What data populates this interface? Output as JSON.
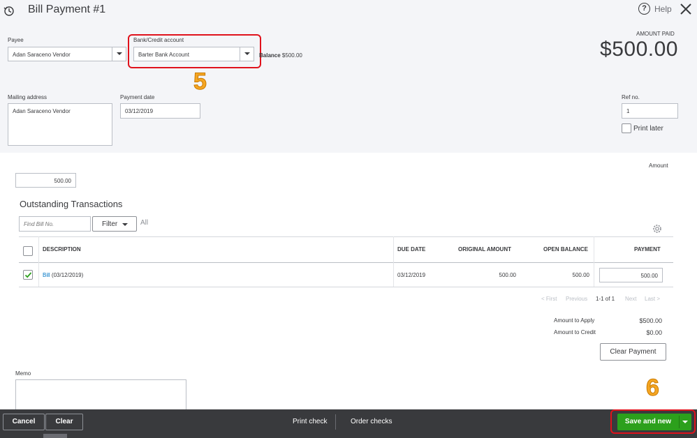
{
  "header": {
    "title": "Bill Payment",
    "number": "#1",
    "help_label": "Help"
  },
  "form": {
    "payee_label": "Payee",
    "payee_value": "Adan Saraceno Vendor",
    "bank_label": "Bank/Credit account",
    "bank_value": "Barter Bank Account",
    "balance_label": "Balance",
    "balance_value": "$500.00",
    "amount_paid_label": "AMOUNT PAID",
    "amount_paid_value": "$500.00",
    "mailing_label": "Mailing address",
    "mailing_value": "Adan Saraceno Vendor",
    "payment_date_label": "Payment date",
    "payment_date_value": "03/12/2019",
    "ref_label": "Ref no.",
    "ref_value": "1",
    "print_later_label": "Print later",
    "amount_label": "Amount",
    "amount_value": "500.00"
  },
  "annotations": {
    "step5": "5",
    "step6": "6"
  },
  "transactions": {
    "title": "Outstanding Transactions",
    "find_placeholder": "Find Bill No.",
    "filter_label": "Filter",
    "all_label": "All",
    "columns": {
      "description": "DESCRIPTION",
      "due_date": "DUE DATE",
      "original_amount": "ORIGINAL AMOUNT",
      "open_balance": "OPEN BALANCE",
      "payment": "PAYMENT"
    },
    "rows": [
      {
        "desc_link": "Bill",
        "desc_rest": "(03/12/2019)",
        "due_date": "03/12/2019",
        "original_amount": "500.00",
        "open_balance": "500.00",
        "payment": "500.00"
      }
    ],
    "pager": {
      "first": "< First",
      "previous": "Previous",
      "range": "1-1 of 1",
      "next": "Next",
      "last": "Last >"
    }
  },
  "summary": {
    "apply_label": "Amount to Apply",
    "apply_value": "$500.00",
    "credit_label": "Amount to Credit",
    "credit_value": "$0.00",
    "clear_payment": "Clear Payment"
  },
  "memo": {
    "label": "Memo",
    "value": ""
  },
  "footer": {
    "cancel": "Cancel",
    "clear": "Clear",
    "print_check": "Print check",
    "order_checks": "Order checks",
    "save_new": "Save and new"
  },
  "colors": {
    "primary_green": "#2ca01c",
    "link_blue": "#0077c5",
    "highlight_red": "#e0121c",
    "step_orange": "#f5a623"
  }
}
